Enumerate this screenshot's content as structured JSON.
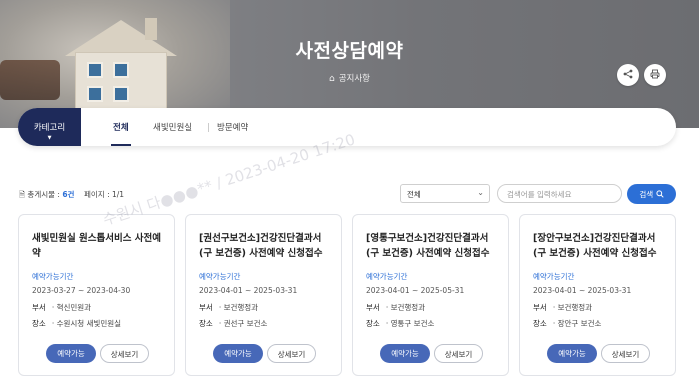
{
  "hero": {
    "title": "사전상담예약",
    "breadcrumb": "공지사항",
    "colors": {
      "overlay": "#7d7e82",
      "accent": "#1e2a5a"
    }
  },
  "actions": {
    "share_icon": "share-icon",
    "print_icon": "print-icon"
  },
  "category": {
    "button_label": "카테고리",
    "tabs": [
      {
        "label": "전체",
        "active": true
      },
      {
        "label": "새빛민원실",
        "active": false
      },
      {
        "label": "방문예약",
        "active": false
      }
    ]
  },
  "toolbar": {
    "total_label": "총게시물 :",
    "total_value": "6건",
    "page_label": "페이지 : 1/1",
    "select_value": "전체",
    "search_placeholder": "검색어를 입력하세요",
    "search_button": "검색"
  },
  "watermark": "수원시 다●●●** / 2023-04-20 17:20",
  "cards": [
    {
      "title": "새빛민원실 원스톱서비스 사전예약",
      "period_label": "예약가능기간",
      "period": "2023-03-27 ~ 2023-04-30",
      "dept_key": "부서",
      "dept": "· 혁신민원과",
      "place_key": "장소",
      "place": "· 수원시청 새빛민원실",
      "btn_reserve": "예약가능",
      "btn_detail": "상세보기"
    },
    {
      "title": "[권선구보건소]건강진단결과서(구 보건증) 사전예약 신청접수",
      "period_label": "예약가능기간",
      "period": "2023-04-01 ~ 2025-03-31",
      "dept_key": "부서",
      "dept": "· 보건행정과",
      "place_key": "장소",
      "place": "· 권선구 보건소",
      "btn_reserve": "예약가능",
      "btn_detail": "상세보기"
    },
    {
      "title": "[영통구보건소]건강진단결과서(구 보건증) 사전예약 신청접수",
      "period_label": "예약가능기간",
      "period": "2023-04-01 ~ 2025-05-31",
      "dept_key": "부서",
      "dept": "· 보건행정과",
      "place_key": "장소",
      "place": "· 영통구 보건소",
      "btn_reserve": "예약가능",
      "btn_detail": "상세보기"
    },
    {
      "title": "[장안구보건소]건강진단결과서(구 보건증) 사전예약 신청접수",
      "period_label": "예약가능기간",
      "period": "2023-04-01 ~ 2025-03-31",
      "dept_key": "부서",
      "dept": "· 보건행정과",
      "place_key": "장소",
      "place": "· 장안구 보건소",
      "btn_reserve": "예약가능",
      "btn_detail": "상세보기"
    }
  ]
}
